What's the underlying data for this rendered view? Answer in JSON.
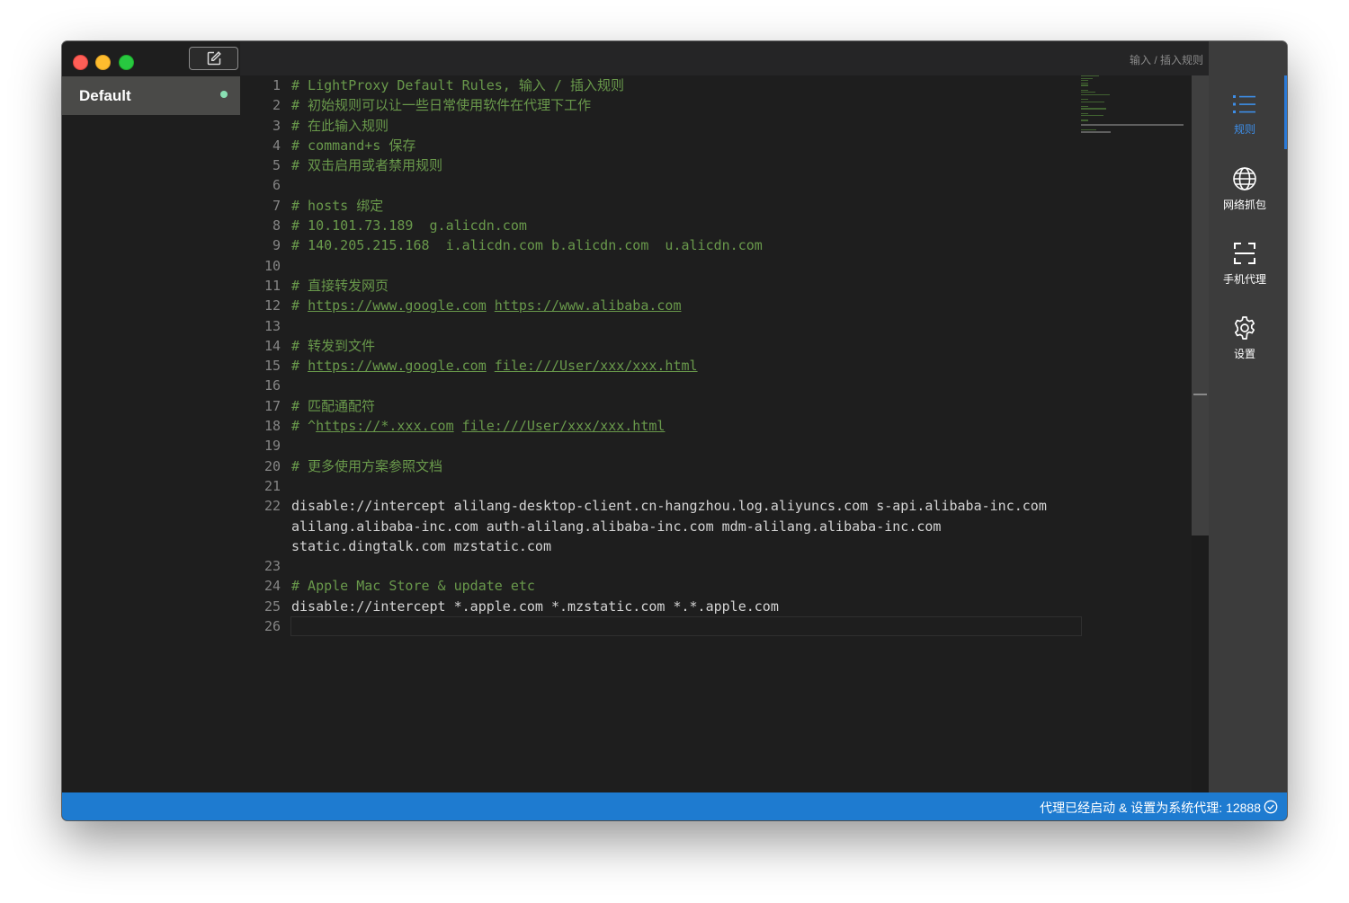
{
  "sidebar": {
    "rules": [
      {
        "name": "Default",
        "enabled": true
      }
    ]
  },
  "editor": {
    "breadcrumb": "输入 / 插入规则",
    "lines": [
      {
        "num": "1",
        "type": "comment",
        "text": "# LightProxy Default Rules, 输入 / 插入规则"
      },
      {
        "num": "2",
        "type": "comment",
        "text": "# 初始规则可以让一些日常使用软件在代理下工作"
      },
      {
        "num": "3",
        "type": "comment",
        "text": "# 在此输入规则"
      },
      {
        "num": "4",
        "type": "comment",
        "text": "# command+s 保存"
      },
      {
        "num": "5",
        "type": "comment",
        "text": "# 双击启用或者禁用规则"
      },
      {
        "num": "6",
        "type": "blank",
        "text": ""
      },
      {
        "num": "7",
        "type": "comment",
        "text": "# hosts 绑定"
      },
      {
        "num": "8",
        "type": "comment",
        "text": "# 10.101.73.189  g.alicdn.com"
      },
      {
        "num": "9",
        "type": "comment",
        "text": "# 140.205.215.168  i.alicdn.com b.alicdn.com  u.alicdn.com"
      },
      {
        "num": "10",
        "type": "blank",
        "text": ""
      },
      {
        "num": "11",
        "type": "comment",
        "text": "# 直接转发网页"
      },
      {
        "num": "12",
        "type": "comment",
        "prefix": "# ",
        "links": [
          "https://www.google.com",
          "https://www.alibaba.com"
        ]
      },
      {
        "num": "13",
        "type": "blank",
        "text": ""
      },
      {
        "num": "14",
        "type": "comment",
        "text": "# 转发到文件"
      },
      {
        "num": "15",
        "type": "comment",
        "prefix": "# ",
        "links": [
          "https://www.google.com",
          "file:///User/xxx/xxx.html"
        ]
      },
      {
        "num": "16",
        "type": "blank",
        "text": ""
      },
      {
        "num": "17",
        "type": "comment",
        "text": "# 匹配通配符"
      },
      {
        "num": "18",
        "type": "comment",
        "prefix": "# ^",
        "links": [
          "https://*.xxx.com",
          "file:///User/xxx/xxx.html"
        ]
      },
      {
        "num": "19",
        "type": "blank",
        "text": ""
      },
      {
        "num": "20",
        "type": "comment",
        "text": "# 更多使用方案参照文档"
      },
      {
        "num": "21",
        "type": "blank",
        "text": ""
      },
      {
        "num": "22",
        "type": "plain",
        "text": "disable://intercept alilang-desktop-client.cn-hangzhou.log.aliyuncs.com s-api.alibaba-inc.com alilang.alibaba-inc.com auth-alilang.alibaba-inc.com mdm-alilang.alibaba-inc.com static.dingtalk.com mzstatic.com"
      },
      {
        "num": "23",
        "type": "blank",
        "text": ""
      },
      {
        "num": "24",
        "type": "comment",
        "text": "# Apple Mac Store & update etc"
      },
      {
        "num": "25",
        "type": "plain",
        "text": "disable://intercept *.apple.com *.mzstatic.com *.*.apple.com"
      },
      {
        "num": "26",
        "type": "current",
        "text": ""
      }
    ]
  },
  "nav": {
    "items": [
      {
        "id": "rules",
        "label": "规则",
        "icon": "list-icon",
        "active": true
      },
      {
        "id": "capture",
        "label": "网络抓包",
        "icon": "globe-icon",
        "active": false
      },
      {
        "id": "mobile",
        "label": "手机代理",
        "icon": "scan-icon",
        "active": false
      },
      {
        "id": "settings",
        "label": "设置",
        "icon": "gear-icon",
        "active": false
      }
    ]
  },
  "status": {
    "text": "代理已经启动 & 设置为系统代理: 12888",
    "icon": "check-circle-icon"
  },
  "colors": {
    "accent": "#1e7bd0",
    "active_nav": "#3d8ee8",
    "comment": "#69994b",
    "enabled_dot": "#89e0b3"
  }
}
